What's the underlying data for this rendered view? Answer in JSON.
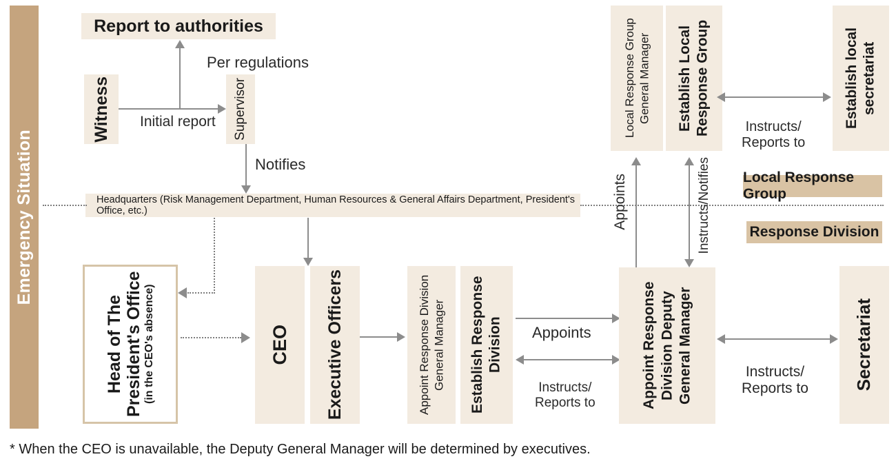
{
  "diagram": {
    "side_band": {
      "label": "Emergency Situation"
    },
    "boxes": {
      "report_authorities": "Report to authorities",
      "witness": "Witness",
      "supervisor": "Supervisor",
      "headquarters": "Headquarters (Risk Management Department, Human Resources & General Affairs Department, President's Office, etc.)",
      "head_presidents_office_main": "Head of The President's Office",
      "head_presidents_office_sub": "(in the CEO's absence)",
      "ceo": "CEO",
      "executive_officers": "Executive Officers",
      "appoint_response_division_gm": "Appoint Response Division General Manager",
      "establish_response_division": "Establish Response Division",
      "appoint_response_division_deputy_gm": "Appoint Response Division Deputy General Manager",
      "secretariat": "Secretariat",
      "local_response_group_gm": "Local Response Group General Manager",
      "establish_local_response_group": "Establish Local Response Group",
      "establish_local_secretariat": "Establish local secretariat"
    },
    "edge_labels": {
      "per_regulations": "Per regulations",
      "initial_report": "Initial report",
      "notifies": "Notifies",
      "appoints_top": "Appoints",
      "instructs_notifies": "Instructs/Notifies",
      "instructs_reports_to_top": "Instructs/\nReports to",
      "appoints_mid": "Appoints",
      "instructs_reports_to_mid": "Instructs/\nReports to",
      "instructs_reports_to_right": "Instructs/\nReports to"
    },
    "legend": {
      "local_response_group": "Local Response Group",
      "response_division": "Response Division"
    },
    "footnote": "* When the CEO is unavailable, the Deputy General Manager will be determined by executives."
  }
}
